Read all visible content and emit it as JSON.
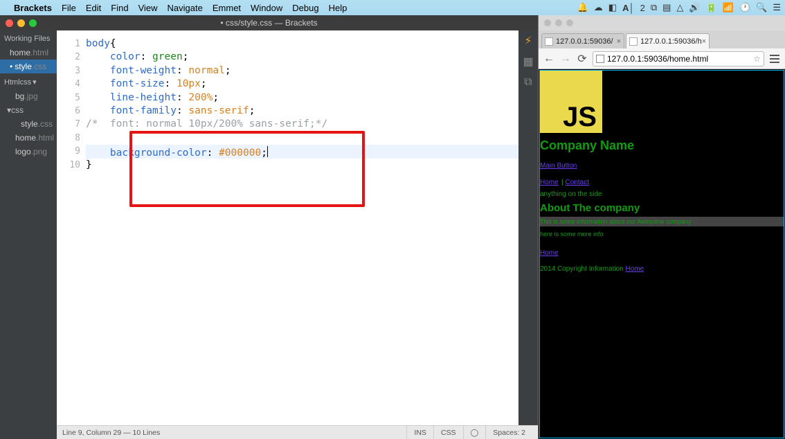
{
  "menubar": {
    "app": "Brackets",
    "items": [
      "File",
      "Edit",
      "Find",
      "View",
      "Navigate",
      "Emmet",
      "Window",
      "Debug",
      "Help"
    ]
  },
  "brackets": {
    "title": "• css/style.css — Brackets",
    "sidebar": {
      "working_header": "Working Files",
      "working": [
        {
          "name": "home",
          "ext": ".html",
          "active": false,
          "dirty": false
        },
        {
          "name": "style",
          "ext": ".css",
          "active": true,
          "dirty": true
        }
      ],
      "project_root": "htmlcss",
      "tree": [
        {
          "name": "bg",
          "ext": ".jpg",
          "indent": 1
        },
        {
          "name": "css",
          "folder": true,
          "indent": 0
        },
        {
          "name": "style",
          "ext": ".css",
          "indent": 2
        },
        {
          "name": "home",
          "ext": ".html",
          "indent": 1
        },
        {
          "name": "logo",
          "ext": ".png",
          "indent": 1
        }
      ]
    },
    "code_lines": [
      {
        "n": 1,
        "raw": "body{",
        "parts": [
          [
            "sel",
            "body"
          ],
          [
            "",
            "{"
          ]
        ]
      },
      {
        "n": 2,
        "raw": "    color: green;",
        "parts": [
          [
            "",
            "    "
          ],
          [
            "prop",
            "color"
          ],
          [
            "",
            ": "
          ],
          [
            "str",
            "green"
          ],
          [
            "",
            ";"
          ]
        ]
      },
      {
        "n": 3,
        "raw": "    font-weight: normal;",
        "parts": [
          [
            "",
            "    "
          ],
          [
            "prop",
            "font-weight"
          ],
          [
            "",
            ": "
          ],
          [
            "val",
            "normal"
          ],
          [
            "",
            ";"
          ]
        ]
      },
      {
        "n": 4,
        "raw": "    font-size: 10px;",
        "parts": [
          [
            "",
            "    "
          ],
          [
            "prop",
            "font-size"
          ],
          [
            "",
            ": "
          ],
          [
            "val",
            "10px"
          ],
          [
            "",
            ";"
          ]
        ]
      },
      {
        "n": 5,
        "raw": "    line-height: 200%;",
        "parts": [
          [
            "",
            "    "
          ],
          [
            "prop",
            "line-height"
          ],
          [
            "",
            ": "
          ],
          [
            "val",
            "200%"
          ],
          [
            "",
            ";"
          ]
        ]
      },
      {
        "n": 6,
        "raw": "    font-family: sans-serif;",
        "parts": [
          [
            "",
            "    "
          ],
          [
            "prop",
            "font-family"
          ],
          [
            "",
            ": "
          ],
          [
            "val",
            "sans-serif"
          ],
          [
            "",
            ";"
          ]
        ]
      },
      {
        "n": 7,
        "raw": "/*  font: normal 10px/200% sans-serif;*/",
        "parts": [
          [
            "comment",
            "/*  font: normal 10px/200% sans-serif;*/"
          ]
        ]
      },
      {
        "n": 8,
        "raw": "",
        "parts": []
      },
      {
        "n": 9,
        "raw": "    background-color: #000000;",
        "cur": true,
        "parts": [
          [
            "",
            "    "
          ],
          [
            "prop",
            "background-color"
          ],
          [
            "",
            ": "
          ],
          [
            "val",
            "#000000"
          ],
          [
            "",
            ";"
          ]
        ]
      },
      {
        "n": 10,
        "raw": "}",
        "parts": [
          [
            "",
            "}"
          ]
        ]
      }
    ],
    "status": {
      "left": "Line 9, Column 29 — 10 Lines",
      "ins": "INS",
      "lang": "CSS",
      "enc": "",
      "spaces": "Spaces:  2"
    }
  },
  "chrome": {
    "tabs": [
      {
        "label": "127.0.0.1:59036/",
        "active": false
      },
      {
        "label": "127.0.0.1:59036/h",
        "active": true
      }
    ],
    "url": "127.0.0.1:59036/home.html",
    "page": {
      "logo": "JS",
      "h1": "Company Name",
      "main_button": "Main Button",
      "nav_home": "Home",
      "nav_sep": " | ",
      "nav_contact": "Contact",
      "aside": "anything on the side",
      "h2": "About The company",
      "para1": "This is some information about our Awesome company",
      "para2": "here is some more info",
      "link_home": "Home",
      "footer_pre": "2014 Copyright Information ",
      "footer_link": "Home"
    }
  }
}
